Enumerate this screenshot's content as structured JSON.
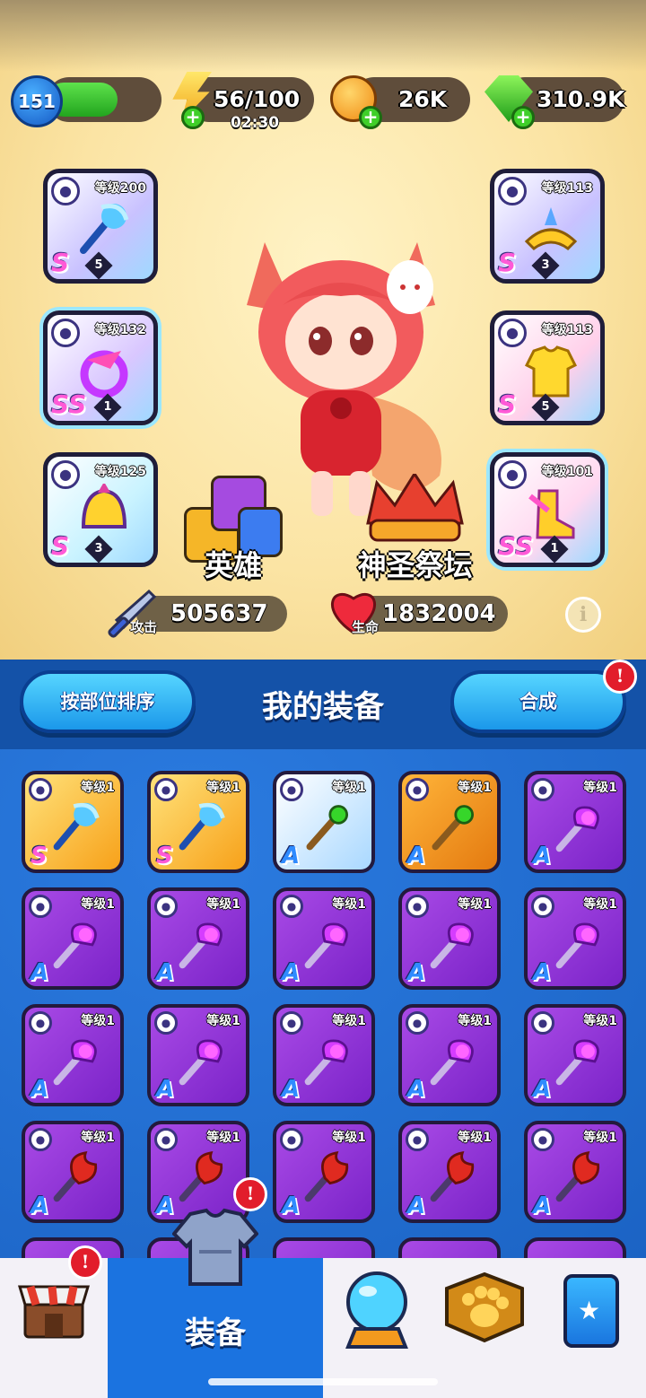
{
  "header": {
    "player_level": "151",
    "xp_progress": 0.62,
    "energy": "56/100",
    "energy_timer": "02:30",
    "coins": "26K",
    "gems": "310.9K"
  },
  "equipped": [
    {
      "level": "等级200",
      "rank": "S",
      "stars": "5",
      "icon": "staff-icon",
      "bg": "#c9c2ff",
      "side": "left"
    },
    {
      "level": "等级132",
      "rank": "SS",
      "stars": "1",
      "icon": "ring-icon",
      "bg": "#d9c7ff",
      "side": "left"
    },
    {
      "level": "等级125",
      "rank": "S",
      "stars": "3",
      "icon": "helmet-icon",
      "bg": "#c9f3ff",
      "side": "left"
    },
    {
      "level": "等级113",
      "rank": "S",
      "stars": "3",
      "icon": "tiara-icon",
      "bg": "#c9c2ff",
      "side": "right"
    },
    {
      "level": "等级113",
      "rank": "S",
      "stars": "5",
      "icon": "armor-icon",
      "bg": "#ffd0ea",
      "side": "right"
    },
    {
      "level": "等级101",
      "rank": "SS",
      "stars": "1",
      "icon": "boots-icon",
      "bg": "#ffd8f0",
      "side": "right"
    }
  ],
  "menu": {
    "heroes": "英雄",
    "altar": "神圣祭坛"
  },
  "stats": {
    "attack_label": "攻击",
    "attack": "505637",
    "hp_label": "生命",
    "hp": "1832004"
  },
  "equipment_bar": {
    "sort_button": "按部位排序",
    "title": "我的装备",
    "merge_button": "合成",
    "merge_badge": "!"
  },
  "inventory": [
    {
      "level": "等级1",
      "rank": "S",
      "icon": "staff-icon",
      "frame": "gold"
    },
    {
      "level": "等级1",
      "rank": "S",
      "icon": "staff-icon",
      "frame": "gold"
    },
    {
      "level": "等级1",
      "rank": "A",
      "icon": "wand-icon",
      "frame": "blue"
    },
    {
      "level": "等级1",
      "rank": "A",
      "icon": "wand-icon",
      "frame": "orange"
    },
    {
      "level": "等级1",
      "rank": "A",
      "icon": "scepter-icon",
      "frame": "purple"
    },
    {
      "level": "等级1",
      "rank": "A",
      "icon": "scepter-icon",
      "frame": "purple"
    },
    {
      "level": "等级1",
      "rank": "A",
      "icon": "scepter-icon",
      "frame": "purple"
    },
    {
      "level": "等级1",
      "rank": "A",
      "icon": "scepter-icon",
      "frame": "purple"
    },
    {
      "level": "等级1",
      "rank": "A",
      "icon": "scepter-icon",
      "frame": "purple"
    },
    {
      "level": "等级1",
      "rank": "A",
      "icon": "scepter-icon",
      "frame": "purple"
    },
    {
      "level": "等级1",
      "rank": "A",
      "icon": "scepter-icon",
      "frame": "purple"
    },
    {
      "level": "等级1",
      "rank": "A",
      "icon": "scepter-icon",
      "frame": "purple"
    },
    {
      "level": "等级1",
      "rank": "A",
      "icon": "scepter-icon",
      "frame": "purple"
    },
    {
      "level": "等级1",
      "rank": "A",
      "icon": "scepter-icon",
      "frame": "purple"
    },
    {
      "level": "等级1",
      "rank": "A",
      "icon": "scepter-icon",
      "frame": "purple"
    },
    {
      "level": "等级1",
      "rank": "A",
      "icon": "flame-staff-icon",
      "frame": "purple"
    },
    {
      "level": "等级1",
      "rank": "A",
      "icon": "flame-staff-icon",
      "frame": "purple"
    },
    {
      "level": "等级1",
      "rank": "A",
      "icon": "flame-staff-icon",
      "frame": "purple"
    },
    {
      "level": "等级1",
      "rank": "A",
      "icon": "flame-staff-icon",
      "frame": "purple"
    },
    {
      "level": "等级1",
      "rank": "A",
      "icon": "flame-staff-icon",
      "frame": "purple"
    }
  ],
  "nav": {
    "active_label": "装备",
    "badge": "!",
    "items": [
      "shop-icon",
      "armor-icon",
      "crystal-ball-icon",
      "paw-icon",
      "star-card-icon"
    ]
  },
  "colors": {
    "accent": "#1b73e0",
    "purple_frame": "#8a2fd6",
    "gold_frame": "#f7b323"
  }
}
